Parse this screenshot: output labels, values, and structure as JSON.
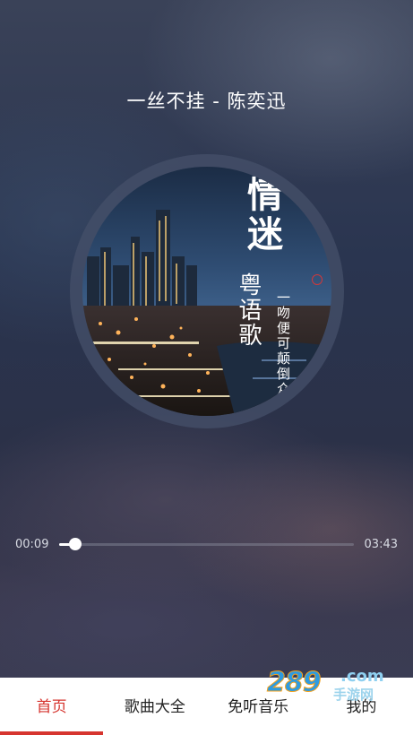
{
  "player": {
    "title": "一丝不挂 - 陈奕迅",
    "album_cover": {
      "main_text": "情迷",
      "sub_text": "粤语歌",
      "line_text": "一吻便可颠倒众生"
    },
    "current_time": "00:09",
    "total_time": "03:43",
    "progress_fraction": 0.055
  },
  "tabs": [
    {
      "label": "首页",
      "active": true
    },
    {
      "label": "歌曲大全",
      "active": false
    },
    {
      "label": "免听音乐",
      "active": false
    },
    {
      "label": "我的",
      "active": false
    }
  ],
  "watermark": {
    "number": "289",
    "suffix": ".com",
    "cn_text": "手游网"
  },
  "colors": {
    "accent": "#d6352f",
    "text_light": "#ffffff"
  }
}
